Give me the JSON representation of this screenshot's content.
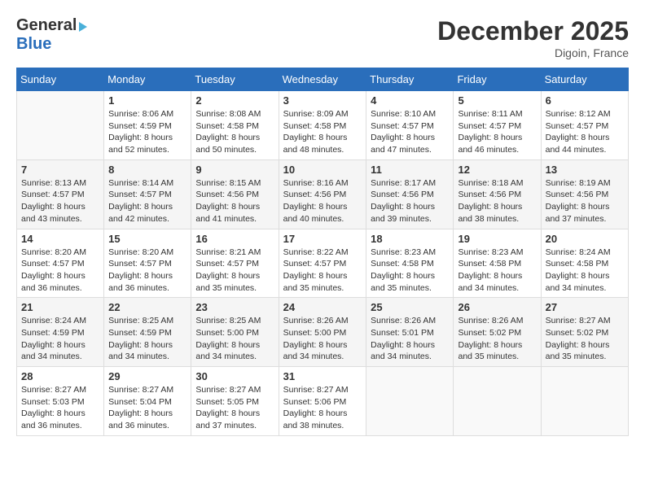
{
  "header": {
    "logo_general": "General",
    "logo_blue": "Blue",
    "month_title": "December 2025",
    "location": "Digoin, France"
  },
  "days_of_week": [
    "Sunday",
    "Monday",
    "Tuesday",
    "Wednesday",
    "Thursday",
    "Friday",
    "Saturday"
  ],
  "weeks": [
    [
      {
        "day": "",
        "sunrise": "",
        "sunset": "",
        "daylight": ""
      },
      {
        "day": "1",
        "sunrise": "Sunrise: 8:06 AM",
        "sunset": "Sunset: 4:59 PM",
        "daylight": "Daylight: 8 hours and 52 minutes."
      },
      {
        "day": "2",
        "sunrise": "Sunrise: 8:08 AM",
        "sunset": "Sunset: 4:58 PM",
        "daylight": "Daylight: 8 hours and 50 minutes."
      },
      {
        "day": "3",
        "sunrise": "Sunrise: 8:09 AM",
        "sunset": "Sunset: 4:58 PM",
        "daylight": "Daylight: 8 hours and 48 minutes."
      },
      {
        "day": "4",
        "sunrise": "Sunrise: 8:10 AM",
        "sunset": "Sunset: 4:57 PM",
        "daylight": "Daylight: 8 hours and 47 minutes."
      },
      {
        "day": "5",
        "sunrise": "Sunrise: 8:11 AM",
        "sunset": "Sunset: 4:57 PM",
        "daylight": "Daylight: 8 hours and 46 minutes."
      },
      {
        "day": "6",
        "sunrise": "Sunrise: 8:12 AM",
        "sunset": "Sunset: 4:57 PM",
        "daylight": "Daylight: 8 hours and 44 minutes."
      }
    ],
    [
      {
        "day": "7",
        "sunrise": "Sunrise: 8:13 AM",
        "sunset": "Sunset: 4:57 PM",
        "daylight": "Daylight: 8 hours and 43 minutes."
      },
      {
        "day": "8",
        "sunrise": "Sunrise: 8:14 AM",
        "sunset": "Sunset: 4:57 PM",
        "daylight": "Daylight: 8 hours and 42 minutes."
      },
      {
        "day": "9",
        "sunrise": "Sunrise: 8:15 AM",
        "sunset": "Sunset: 4:56 PM",
        "daylight": "Daylight: 8 hours and 41 minutes."
      },
      {
        "day": "10",
        "sunrise": "Sunrise: 8:16 AM",
        "sunset": "Sunset: 4:56 PM",
        "daylight": "Daylight: 8 hours and 40 minutes."
      },
      {
        "day": "11",
        "sunrise": "Sunrise: 8:17 AM",
        "sunset": "Sunset: 4:56 PM",
        "daylight": "Daylight: 8 hours and 39 minutes."
      },
      {
        "day": "12",
        "sunrise": "Sunrise: 8:18 AM",
        "sunset": "Sunset: 4:56 PM",
        "daylight": "Daylight: 8 hours and 38 minutes."
      },
      {
        "day": "13",
        "sunrise": "Sunrise: 8:19 AM",
        "sunset": "Sunset: 4:56 PM",
        "daylight": "Daylight: 8 hours and 37 minutes."
      }
    ],
    [
      {
        "day": "14",
        "sunrise": "Sunrise: 8:20 AM",
        "sunset": "Sunset: 4:57 PM",
        "daylight": "Daylight: 8 hours and 36 minutes."
      },
      {
        "day": "15",
        "sunrise": "Sunrise: 8:20 AM",
        "sunset": "Sunset: 4:57 PM",
        "daylight": "Daylight: 8 hours and 36 minutes."
      },
      {
        "day": "16",
        "sunrise": "Sunrise: 8:21 AM",
        "sunset": "Sunset: 4:57 PM",
        "daylight": "Daylight: 8 hours and 35 minutes."
      },
      {
        "day": "17",
        "sunrise": "Sunrise: 8:22 AM",
        "sunset": "Sunset: 4:57 PM",
        "daylight": "Daylight: 8 hours and 35 minutes."
      },
      {
        "day": "18",
        "sunrise": "Sunrise: 8:23 AM",
        "sunset": "Sunset: 4:58 PM",
        "daylight": "Daylight: 8 hours and 35 minutes."
      },
      {
        "day": "19",
        "sunrise": "Sunrise: 8:23 AM",
        "sunset": "Sunset: 4:58 PM",
        "daylight": "Daylight: 8 hours and 34 minutes."
      },
      {
        "day": "20",
        "sunrise": "Sunrise: 8:24 AM",
        "sunset": "Sunset: 4:58 PM",
        "daylight": "Daylight: 8 hours and 34 minutes."
      }
    ],
    [
      {
        "day": "21",
        "sunrise": "Sunrise: 8:24 AM",
        "sunset": "Sunset: 4:59 PM",
        "daylight": "Daylight: 8 hours and 34 minutes."
      },
      {
        "day": "22",
        "sunrise": "Sunrise: 8:25 AM",
        "sunset": "Sunset: 4:59 PM",
        "daylight": "Daylight: 8 hours and 34 minutes."
      },
      {
        "day": "23",
        "sunrise": "Sunrise: 8:25 AM",
        "sunset": "Sunset: 5:00 PM",
        "daylight": "Daylight: 8 hours and 34 minutes."
      },
      {
        "day": "24",
        "sunrise": "Sunrise: 8:26 AM",
        "sunset": "Sunset: 5:00 PM",
        "daylight": "Daylight: 8 hours and 34 minutes."
      },
      {
        "day": "25",
        "sunrise": "Sunrise: 8:26 AM",
        "sunset": "Sunset: 5:01 PM",
        "daylight": "Daylight: 8 hours and 34 minutes."
      },
      {
        "day": "26",
        "sunrise": "Sunrise: 8:26 AM",
        "sunset": "Sunset: 5:02 PM",
        "daylight": "Daylight: 8 hours and 35 minutes."
      },
      {
        "day": "27",
        "sunrise": "Sunrise: 8:27 AM",
        "sunset": "Sunset: 5:02 PM",
        "daylight": "Daylight: 8 hours and 35 minutes."
      }
    ],
    [
      {
        "day": "28",
        "sunrise": "Sunrise: 8:27 AM",
        "sunset": "Sunset: 5:03 PM",
        "daylight": "Daylight: 8 hours and 36 minutes."
      },
      {
        "day": "29",
        "sunrise": "Sunrise: 8:27 AM",
        "sunset": "Sunset: 5:04 PM",
        "daylight": "Daylight: 8 hours and 36 minutes."
      },
      {
        "day": "30",
        "sunrise": "Sunrise: 8:27 AM",
        "sunset": "Sunset: 5:05 PM",
        "daylight": "Daylight: 8 hours and 37 minutes."
      },
      {
        "day": "31",
        "sunrise": "Sunrise: 8:27 AM",
        "sunset": "Sunset: 5:06 PM",
        "daylight": "Daylight: 8 hours and 38 minutes."
      },
      {
        "day": "",
        "sunrise": "",
        "sunset": "",
        "daylight": ""
      },
      {
        "day": "",
        "sunrise": "",
        "sunset": "",
        "daylight": ""
      },
      {
        "day": "",
        "sunrise": "",
        "sunset": "",
        "daylight": ""
      }
    ]
  ]
}
